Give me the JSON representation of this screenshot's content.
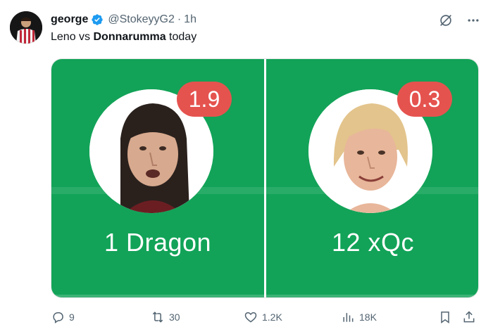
{
  "tweet": {
    "author_name": "george",
    "handle": "@StokeyyG2",
    "separator": "·",
    "time": "1h",
    "text_prefix": "Leno vs ",
    "text_bold": "Donnarumma",
    "text_suffix": " today"
  },
  "media": {
    "players": [
      {
        "rating": "1.9",
        "label": "1 Dragon"
      },
      {
        "rating": "0.3",
        "label": "12 xQc"
      }
    ]
  },
  "actions": {
    "replies": "9",
    "reposts": "30",
    "likes": "1.2K",
    "views": "18K"
  },
  "colors": {
    "pitch_green": "#12a358",
    "badge_red": "#e5534f",
    "verified_blue": "#1d9bf0",
    "secondary_text": "#536471"
  }
}
